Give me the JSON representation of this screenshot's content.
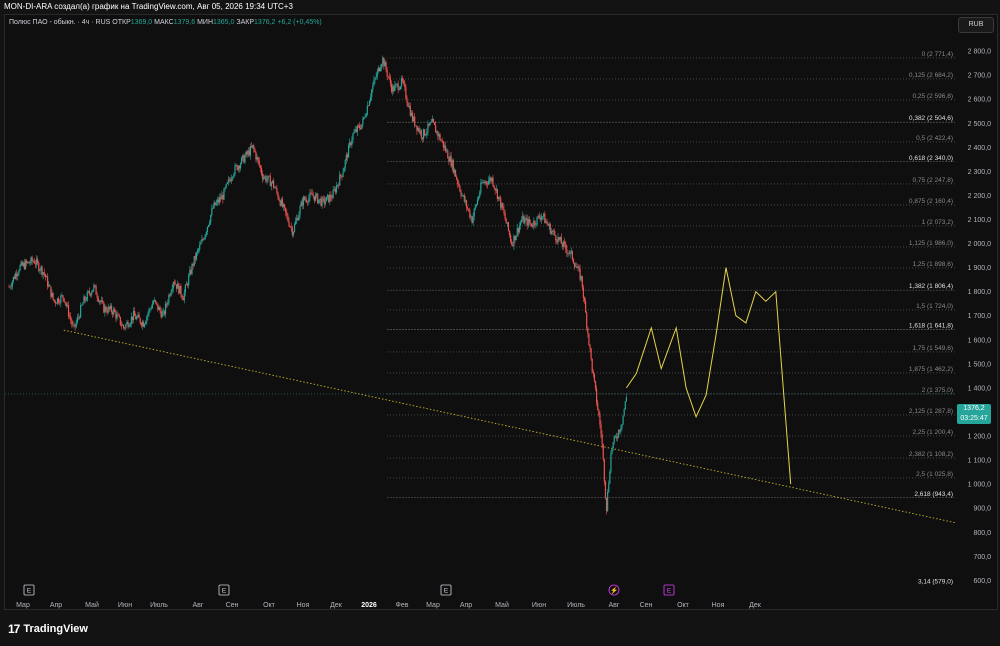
{
  "window": {
    "title": "MON-DI-ARA создал(а) график на TradingView.com, Авг 05, 2026 19:34 UTC+3"
  },
  "legend": {
    "symbol": "Полюс ПАО - обыкн. · 4ч · RUS",
    "open_label": "ОТКР",
    "open": "1369,0",
    "high_label": "МАКС",
    "high": "1379,6",
    "low_label": "МИН",
    "low": "1365,0",
    "close_label": "ЗАКР",
    "close": "1376,2",
    "change": "+6,2 (+0,45%)"
  },
  "currency": "RUB",
  "price_label": {
    "price": "1376,2",
    "countdown": "03:25:47"
  },
  "y_axis_ticks": [
    "2 900,0",
    "2 800,0",
    "2 700,0",
    "2 600,0",
    "2 500,0",
    "2 400,0",
    "2 300,0",
    "2 200,0",
    "2 100,0",
    "2 000,0",
    "1 900,0",
    "1 800,0",
    "1 700,0",
    "1 600,0",
    "1 500,0",
    "1 400,0",
    "1 300,0",
    "1 200,0",
    "1 100,0",
    "1 000,0",
    "900,0",
    "800,0",
    "700,0",
    "600,0"
  ],
  "x_axis_ticks": [
    "Мар",
    "Апр",
    "Май",
    "Июн",
    "Июль",
    "Авг",
    "Сен",
    "Окт",
    "Ноя",
    "Дек",
    "2026",
    "Фев",
    "Мар",
    "Апр",
    "Май",
    "Июн",
    "Июль",
    "Авг",
    "Сен",
    "Окт",
    "Ноя",
    "Дек"
  ],
  "fib_levels": [
    {
      "label": "0 (2 771,4)",
      "price": 2771.4,
      "bold": false
    },
    {
      "label": "0,125 (2 684,2)",
      "price": 2684.2,
      "bold": false
    },
    {
      "label": "0,25 (2 596,8)",
      "price": 2596.8,
      "bold": false
    },
    {
      "label": "0,382 (2 504,6)",
      "price": 2504.6,
      "bold": true
    },
    {
      "label": "0,5 (2 422,4)",
      "price": 2422.4,
      "bold": false
    },
    {
      "label": "0,618 (2 340,0)",
      "price": 2340.0,
      "bold": true
    },
    {
      "label": "0,75 (2 247,8)",
      "price": 2247.8,
      "bold": false
    },
    {
      "label": "0,875 (2 160,4)",
      "price": 2160.4,
      "bold": false
    },
    {
      "label": "1 (2 073,2)",
      "price": 2073.2,
      "bold": false
    },
    {
      "label": "1,125 (1 986,0)",
      "price": 1986.0,
      "bold": false
    },
    {
      "label": "1,25 (1 898,6)",
      "price": 1898.6,
      "bold": false
    },
    {
      "label": "1,382 (1 806,4)",
      "price": 1806.4,
      "bold": true
    },
    {
      "label": "1,5 (1 724,0)",
      "price": 1724.0,
      "bold": false
    },
    {
      "label": "1,618 (1 641,8)",
      "price": 1641.8,
      "bold": true
    },
    {
      "label": "1,75 (1 549,6)",
      "price": 1549.6,
      "bold": false
    },
    {
      "label": "1,875 (1 462,2)",
      "price": 1462.2,
      "bold": false
    },
    {
      "label": "2 (1 375,0)",
      "price": 1375.0,
      "bold": false
    },
    {
      "label": "2,125 (1 287,8)",
      "price": 1287.8,
      "bold": false
    },
    {
      "label": "2,25 (1 200,4)",
      "price": 1200.4,
      "bold": false
    },
    {
      "label": "2,382 (1 108,2)",
      "price": 1108.2,
      "bold": false
    },
    {
      "label": "2,5 (1 025,8)",
      "price": 1025.8,
      "bold": false
    },
    {
      "label": "2,618 (943,4)",
      "price": 943.4,
      "bold": true
    },
    {
      "label": "3,14 (579,0)",
      "price": 579.0,
      "bold": true
    }
  ],
  "event_markers": [
    {
      "icon": "earnings-e-icon",
      "label": "E",
      "color": "#d1d4dc"
    },
    {
      "icon": "earnings-e-icon",
      "label": "E",
      "color": "#d1d4dc"
    },
    {
      "icon": "earnings-e-icon",
      "label": "E",
      "color": "#d1d4dc"
    },
    {
      "icon": "dividend-bolt-icon",
      "label": "⚡",
      "color": "#e040fb"
    },
    {
      "icon": "earnings-e-icon",
      "label": "E",
      "color": "#e040fb"
    }
  ],
  "price_path": [
    [
      0,
      1820
    ],
    [
      2,
      1900
    ],
    [
      5,
      1930
    ],
    [
      7,
      1880
    ],
    [
      9,
      1760
    ],
    [
      11,
      1780
    ],
    [
      13,
      1640
    ],
    [
      15,
      1760
    ],
    [
      17,
      1820
    ],
    [
      19,
      1730
    ],
    [
      21,
      1720
    ],
    [
      23,
      1650
    ],
    [
      25,
      1700
    ],
    [
      27,
      1670
    ],
    [
      29,
      1760
    ],
    [
      31,
      1700
    ],
    [
      33,
      1850
    ],
    [
      35,
      1780
    ],
    [
      37,
      1920
    ],
    [
      39,
      2020
    ],
    [
      41,
      2150
    ],
    [
      43,
      2200
    ],
    [
      45,
      2300
    ],
    [
      47,
      2350
    ],
    [
      49,
      2400
    ],
    [
      51,
      2280
    ],
    [
      53,
      2250
    ],
    [
      55,
      2150
    ],
    [
      57,
      2050
    ],
    [
      59,
      2180
    ],
    [
      61,
      2200
    ],
    [
      63,
      2170
    ],
    [
      65,
      2200
    ],
    [
      67,
      2300
    ],
    [
      69,
      2450
    ],
    [
      71,
      2500
    ],
    [
      73,
      2650
    ],
    [
      75,
      2770
    ],
    [
      77,
      2640
    ],
    [
      79,
      2670
    ],
    [
      81,
      2520
    ],
    [
      83,
      2450
    ],
    [
      85,
      2500
    ],
    [
      87,
      2420
    ],
    [
      89,
      2330
    ],
    [
      91,
      2200
    ],
    [
      93,
      2100
    ],
    [
      95,
      2250
    ],
    [
      97,
      2270
    ],
    [
      99,
      2150
    ],
    [
      101,
      2000
    ],
    [
      103,
      2100
    ],
    [
      105,
      2080
    ],
    [
      107,
      2120
    ],
    [
      109,
      2050
    ],
    [
      111,
      2000
    ],
    [
      113,
      1950
    ],
    [
      115,
      1850
    ],
    [
      117,
      1500
    ],
    [
      119,
      1200
    ],
    [
      120,
      900
    ],
    [
      121,
      1150
    ],
    [
      123,
      1250
    ],
    [
      124,
      1360
    ]
  ],
  "forecast_path": [
    [
      124,
      1400
    ],
    [
      126,
      1460
    ],
    [
      129,
      1650
    ],
    [
      131,
      1480
    ],
    [
      134,
      1650
    ],
    [
      136,
      1400
    ],
    [
      138,
      1280
    ],
    [
      140,
      1370
    ],
    [
      142,
      1620
    ],
    [
      144,
      1900
    ],
    [
      146,
      1700
    ],
    [
      148,
      1670
    ],
    [
      150,
      1800
    ],
    [
      152,
      1760
    ],
    [
      154,
      1800
    ],
    [
      157,
      1000
    ]
  ],
  "trendline": {
    "from": [
      11,
      1640
    ],
    "to": [
      190,
      840
    ]
  },
  "brand": {
    "name": "TradingView",
    "logo_icon": "tradingview-logo-icon"
  },
  "colors": {
    "up": "#26a69a",
    "down": "#ef5350",
    "forecast": "#e6d44a",
    "trend": "#c8b428",
    "fib": "#6a6a6a",
    "bg": "#0f0f0f"
  }
}
